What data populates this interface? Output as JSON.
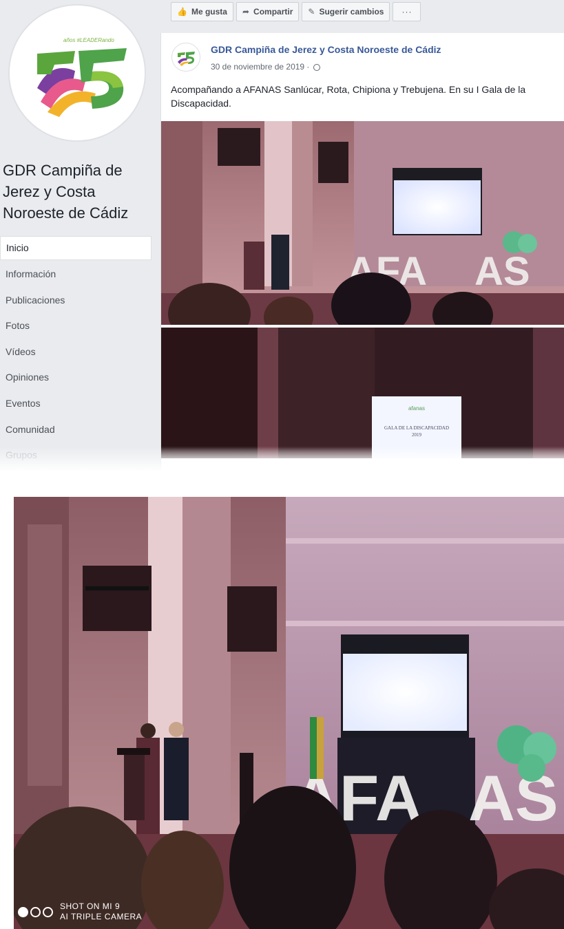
{
  "page": {
    "name_lines": [
      "GDR Campiña de",
      "Jerez y Costa",
      "Noroeste de Cádiz"
    ],
    "logo_tagline": "años #LEADERando",
    "logo_number": "25"
  },
  "nav": {
    "items": [
      {
        "label": "Inicio",
        "state": "active"
      },
      {
        "label": "Información",
        "state": "normal"
      },
      {
        "label": "Publicaciones",
        "state": "normal"
      },
      {
        "label": "Fotos",
        "state": "normal"
      },
      {
        "label": "Vídeos",
        "state": "normal"
      },
      {
        "label": "Opiniones",
        "state": "normal"
      },
      {
        "label": "Eventos",
        "state": "normal"
      },
      {
        "label": "Comunidad",
        "state": "normal"
      },
      {
        "label": "Grupos",
        "state": "faded"
      }
    ]
  },
  "actions": {
    "like_label": "Me gusta",
    "share_label": "Compartir",
    "suggest_label": "Sugerir cambios",
    "more_label": "···"
  },
  "post": {
    "author": "GDR Campiña de Jerez y Costa Noroeste de Cádiz",
    "date": "30 de noviembre de 2019 ·",
    "text": "Acompañando a AFANAS Sanlúcar, Rota, Chipiona y Trebujena. En su I Gala de la Discapacidad.",
    "screen_title": "GALA DE LA DISCAPACIDAD",
    "screen_year": "2019",
    "screen_logo": "afanas"
  },
  "watermark": {
    "line1": "SHOT ON MI 9",
    "line2": "AI TRIPLE CAMERA"
  },
  "colors": {
    "fb_bg": "#e9ebee",
    "link_blue": "#385898",
    "wall": "#b07e84",
    "screen": "#f3f6ff",
    "afanas_green": "#58b98a"
  }
}
